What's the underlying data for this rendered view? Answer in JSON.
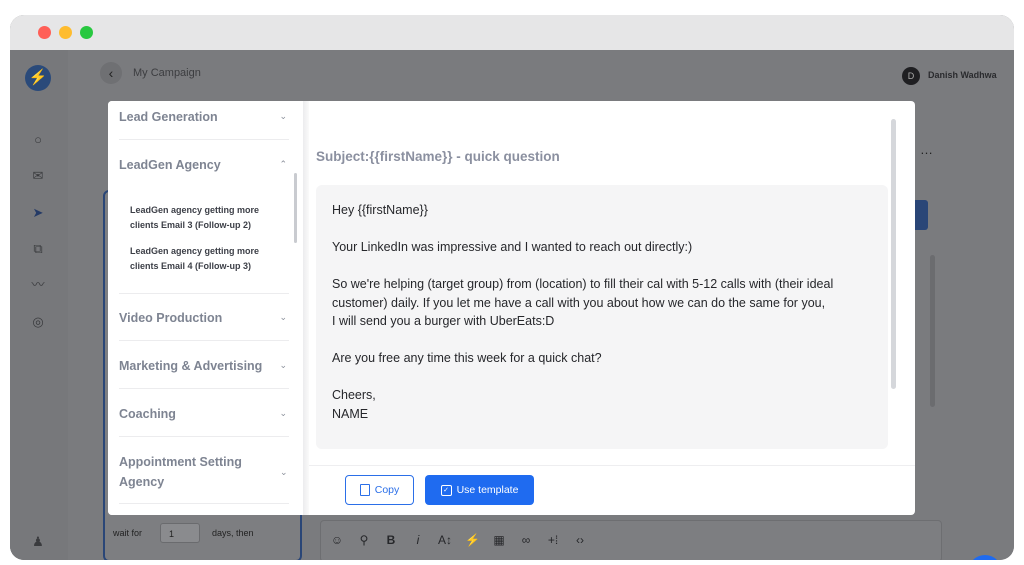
{
  "window": {
    "traffic_lights": [
      "close",
      "minimize",
      "maximize"
    ]
  },
  "app": {
    "breadcrumb": "My Campaign",
    "user": {
      "initial": "D",
      "name": "Danish Wadhwa"
    },
    "rail_icons": [
      "search-icon",
      "mail-icon",
      "send-icon",
      "copy-icon",
      "trend-icon",
      "user-circle-icon"
    ],
    "step": {
      "wait_label": "wait for",
      "wait_value": "1",
      "days_label": "days, then"
    }
  },
  "templates": {
    "categories": [
      {
        "label": "Lead Generation",
        "expanded": false
      },
      {
        "label": "LeadGen Agency",
        "expanded": true,
        "items": [
          "LeadGen agency getting more clients Email 3 (Follow-up 2)",
          "LeadGen agency getting more clients Email 4 (Follow-up 3)"
        ]
      },
      {
        "label": "Video Production",
        "expanded": false
      },
      {
        "label": "Marketing & Advertising",
        "expanded": false
      },
      {
        "label": "Coaching",
        "expanded": false
      },
      {
        "label": "Appointment Setting Agency",
        "expanded": false
      }
    ]
  },
  "preview": {
    "subject": "Subject:{{firstName}} - quick question",
    "body": [
      "Hey {{firstName}}",
      "Your LinkedIn was impressive and I wanted to reach out directly:)",
      "So we're helping (target group) from (location) to fill their cal with 5-12 calls with (their ideal\ncustomer) daily. If you let me have a call with you about how we can do the same for you,\nI will send you a burger with UberEats:D",
      "Are you free any time this week for a quick chat?",
      "Cheers,\nNAME"
    ]
  },
  "actions": {
    "copy": "Copy",
    "use_template": "Use template"
  },
  "colors": {
    "accent": "#1f6bf0",
    "overlay": "#7e7f82"
  }
}
